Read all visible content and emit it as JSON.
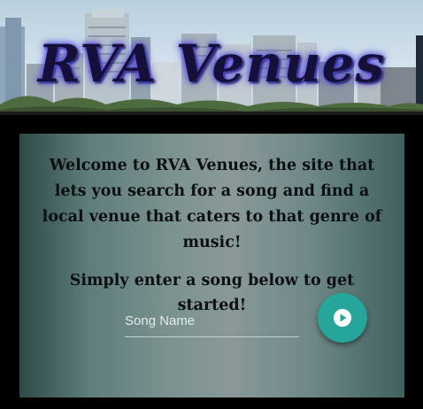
{
  "header": {
    "title": "RVA Venues"
  },
  "intro": {
    "welcome_text": "Welcome to RVA Venues, the site that lets you search for a song and find a local venue that caters to that genre of music!",
    "instruction_text": "Simply enter a song below to get started!"
  },
  "search": {
    "placeholder": "Song Name",
    "value": "",
    "submit_icon": "play-circle-icon"
  },
  "colors": {
    "accent": "#26a69a",
    "title_glow": "#5b52e6",
    "title_text": "#15103a",
    "page_background": "#000000"
  }
}
